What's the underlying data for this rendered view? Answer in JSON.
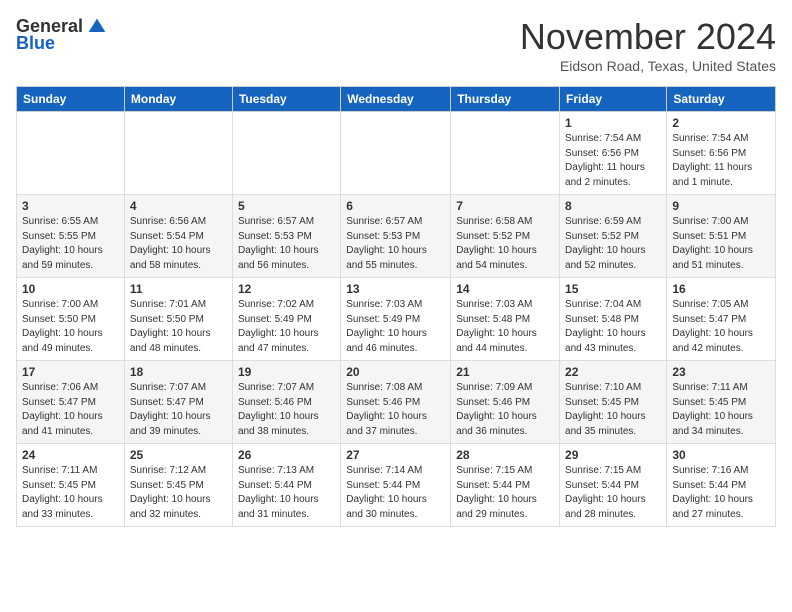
{
  "header": {
    "logo_general": "General",
    "logo_blue": "Blue",
    "month_title": "November 2024",
    "location": "Eidson Road, Texas, United States"
  },
  "weekdays": [
    "Sunday",
    "Monday",
    "Tuesday",
    "Wednesday",
    "Thursday",
    "Friday",
    "Saturday"
  ],
  "weeks": [
    [
      {
        "day": "",
        "info": ""
      },
      {
        "day": "",
        "info": ""
      },
      {
        "day": "",
        "info": ""
      },
      {
        "day": "",
        "info": ""
      },
      {
        "day": "",
        "info": ""
      },
      {
        "day": "1",
        "info": "Sunrise: 7:54 AM\nSunset: 6:56 PM\nDaylight: 11 hours and 2 minutes."
      },
      {
        "day": "2",
        "info": "Sunrise: 7:54 AM\nSunset: 6:56 PM\nDaylight: 11 hours and 1 minute."
      }
    ],
    [
      {
        "day": "3",
        "info": "Sunrise: 6:55 AM\nSunset: 5:55 PM\nDaylight: 10 hours and 59 minutes."
      },
      {
        "day": "4",
        "info": "Sunrise: 6:56 AM\nSunset: 5:54 PM\nDaylight: 10 hours and 58 minutes."
      },
      {
        "day": "5",
        "info": "Sunrise: 6:57 AM\nSunset: 5:53 PM\nDaylight: 10 hours and 56 minutes."
      },
      {
        "day": "6",
        "info": "Sunrise: 6:57 AM\nSunset: 5:53 PM\nDaylight: 10 hours and 55 minutes."
      },
      {
        "day": "7",
        "info": "Sunrise: 6:58 AM\nSunset: 5:52 PM\nDaylight: 10 hours and 54 minutes."
      },
      {
        "day": "8",
        "info": "Sunrise: 6:59 AM\nSunset: 5:52 PM\nDaylight: 10 hours and 52 minutes."
      },
      {
        "day": "9",
        "info": "Sunrise: 7:00 AM\nSunset: 5:51 PM\nDaylight: 10 hours and 51 minutes."
      }
    ],
    [
      {
        "day": "10",
        "info": "Sunrise: 7:00 AM\nSunset: 5:50 PM\nDaylight: 10 hours and 49 minutes."
      },
      {
        "day": "11",
        "info": "Sunrise: 7:01 AM\nSunset: 5:50 PM\nDaylight: 10 hours and 48 minutes."
      },
      {
        "day": "12",
        "info": "Sunrise: 7:02 AM\nSunset: 5:49 PM\nDaylight: 10 hours and 47 minutes."
      },
      {
        "day": "13",
        "info": "Sunrise: 7:03 AM\nSunset: 5:49 PM\nDaylight: 10 hours and 46 minutes."
      },
      {
        "day": "14",
        "info": "Sunrise: 7:03 AM\nSunset: 5:48 PM\nDaylight: 10 hours and 44 minutes."
      },
      {
        "day": "15",
        "info": "Sunrise: 7:04 AM\nSunset: 5:48 PM\nDaylight: 10 hours and 43 minutes."
      },
      {
        "day": "16",
        "info": "Sunrise: 7:05 AM\nSunset: 5:47 PM\nDaylight: 10 hours and 42 minutes."
      }
    ],
    [
      {
        "day": "17",
        "info": "Sunrise: 7:06 AM\nSunset: 5:47 PM\nDaylight: 10 hours and 41 minutes."
      },
      {
        "day": "18",
        "info": "Sunrise: 7:07 AM\nSunset: 5:47 PM\nDaylight: 10 hours and 39 minutes."
      },
      {
        "day": "19",
        "info": "Sunrise: 7:07 AM\nSunset: 5:46 PM\nDaylight: 10 hours and 38 minutes."
      },
      {
        "day": "20",
        "info": "Sunrise: 7:08 AM\nSunset: 5:46 PM\nDaylight: 10 hours and 37 minutes."
      },
      {
        "day": "21",
        "info": "Sunrise: 7:09 AM\nSunset: 5:46 PM\nDaylight: 10 hours and 36 minutes."
      },
      {
        "day": "22",
        "info": "Sunrise: 7:10 AM\nSunset: 5:45 PM\nDaylight: 10 hours and 35 minutes."
      },
      {
        "day": "23",
        "info": "Sunrise: 7:11 AM\nSunset: 5:45 PM\nDaylight: 10 hours and 34 minutes."
      }
    ],
    [
      {
        "day": "24",
        "info": "Sunrise: 7:11 AM\nSunset: 5:45 PM\nDaylight: 10 hours and 33 minutes."
      },
      {
        "day": "25",
        "info": "Sunrise: 7:12 AM\nSunset: 5:45 PM\nDaylight: 10 hours and 32 minutes."
      },
      {
        "day": "26",
        "info": "Sunrise: 7:13 AM\nSunset: 5:44 PM\nDaylight: 10 hours and 31 minutes."
      },
      {
        "day": "27",
        "info": "Sunrise: 7:14 AM\nSunset: 5:44 PM\nDaylight: 10 hours and 30 minutes."
      },
      {
        "day": "28",
        "info": "Sunrise: 7:15 AM\nSunset: 5:44 PM\nDaylight: 10 hours and 29 minutes."
      },
      {
        "day": "29",
        "info": "Sunrise: 7:15 AM\nSunset: 5:44 PM\nDaylight: 10 hours and 28 minutes."
      },
      {
        "day": "30",
        "info": "Sunrise: 7:16 AM\nSunset: 5:44 PM\nDaylight: 10 hours and 27 minutes."
      }
    ]
  ]
}
